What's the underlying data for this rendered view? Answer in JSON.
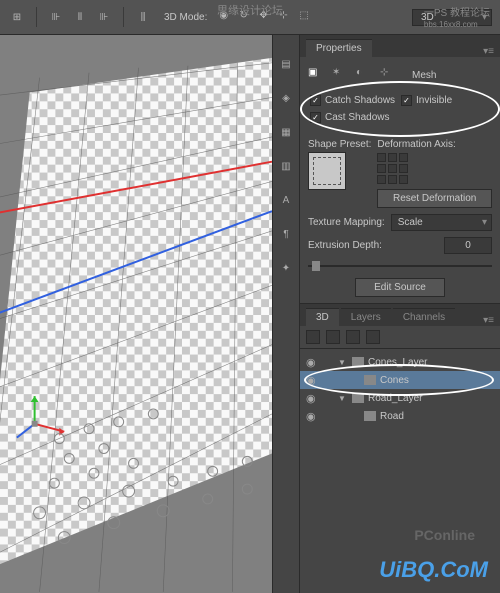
{
  "toolbar": {
    "mode_label": "3D Mode:",
    "dropdown_value": "3D"
  },
  "properties": {
    "tab_label": "Properties",
    "section_label": "Mesh",
    "catch_shadows": "Catch Shadows",
    "cast_shadows": "Cast Shadows",
    "invisible": "Invisible",
    "shape_preset": "Shape Preset:",
    "deformation_axis": "Deformation Axis:",
    "reset_deformation": "Reset Deformation",
    "texture_mapping": "Texture Mapping:",
    "texture_value": "Scale",
    "extrusion_depth": "Extrusion Depth:",
    "extrusion_value": "0",
    "edit_source": "Edit Source"
  },
  "panels3d": {
    "tab_3d": "3D",
    "tab_layers": "Layers",
    "tab_channels": "Channels",
    "tree": [
      {
        "name": "Cones_Layer",
        "indent": 1,
        "expanded": true,
        "visible": true
      },
      {
        "name": "Cones",
        "indent": 2,
        "selected": true,
        "visible": true
      },
      {
        "name": "Road_Layer",
        "indent": 1,
        "expanded": true,
        "visible": true
      },
      {
        "name": "Road",
        "indent": 2,
        "visible": true
      }
    ]
  },
  "watermarks": {
    "top": "思缘设计论坛",
    "top2": "一PS 教程论坛",
    "top3": "bbs.16xx8.com",
    "pc": "PConline",
    "bottom": "UiBQ.CoM"
  }
}
